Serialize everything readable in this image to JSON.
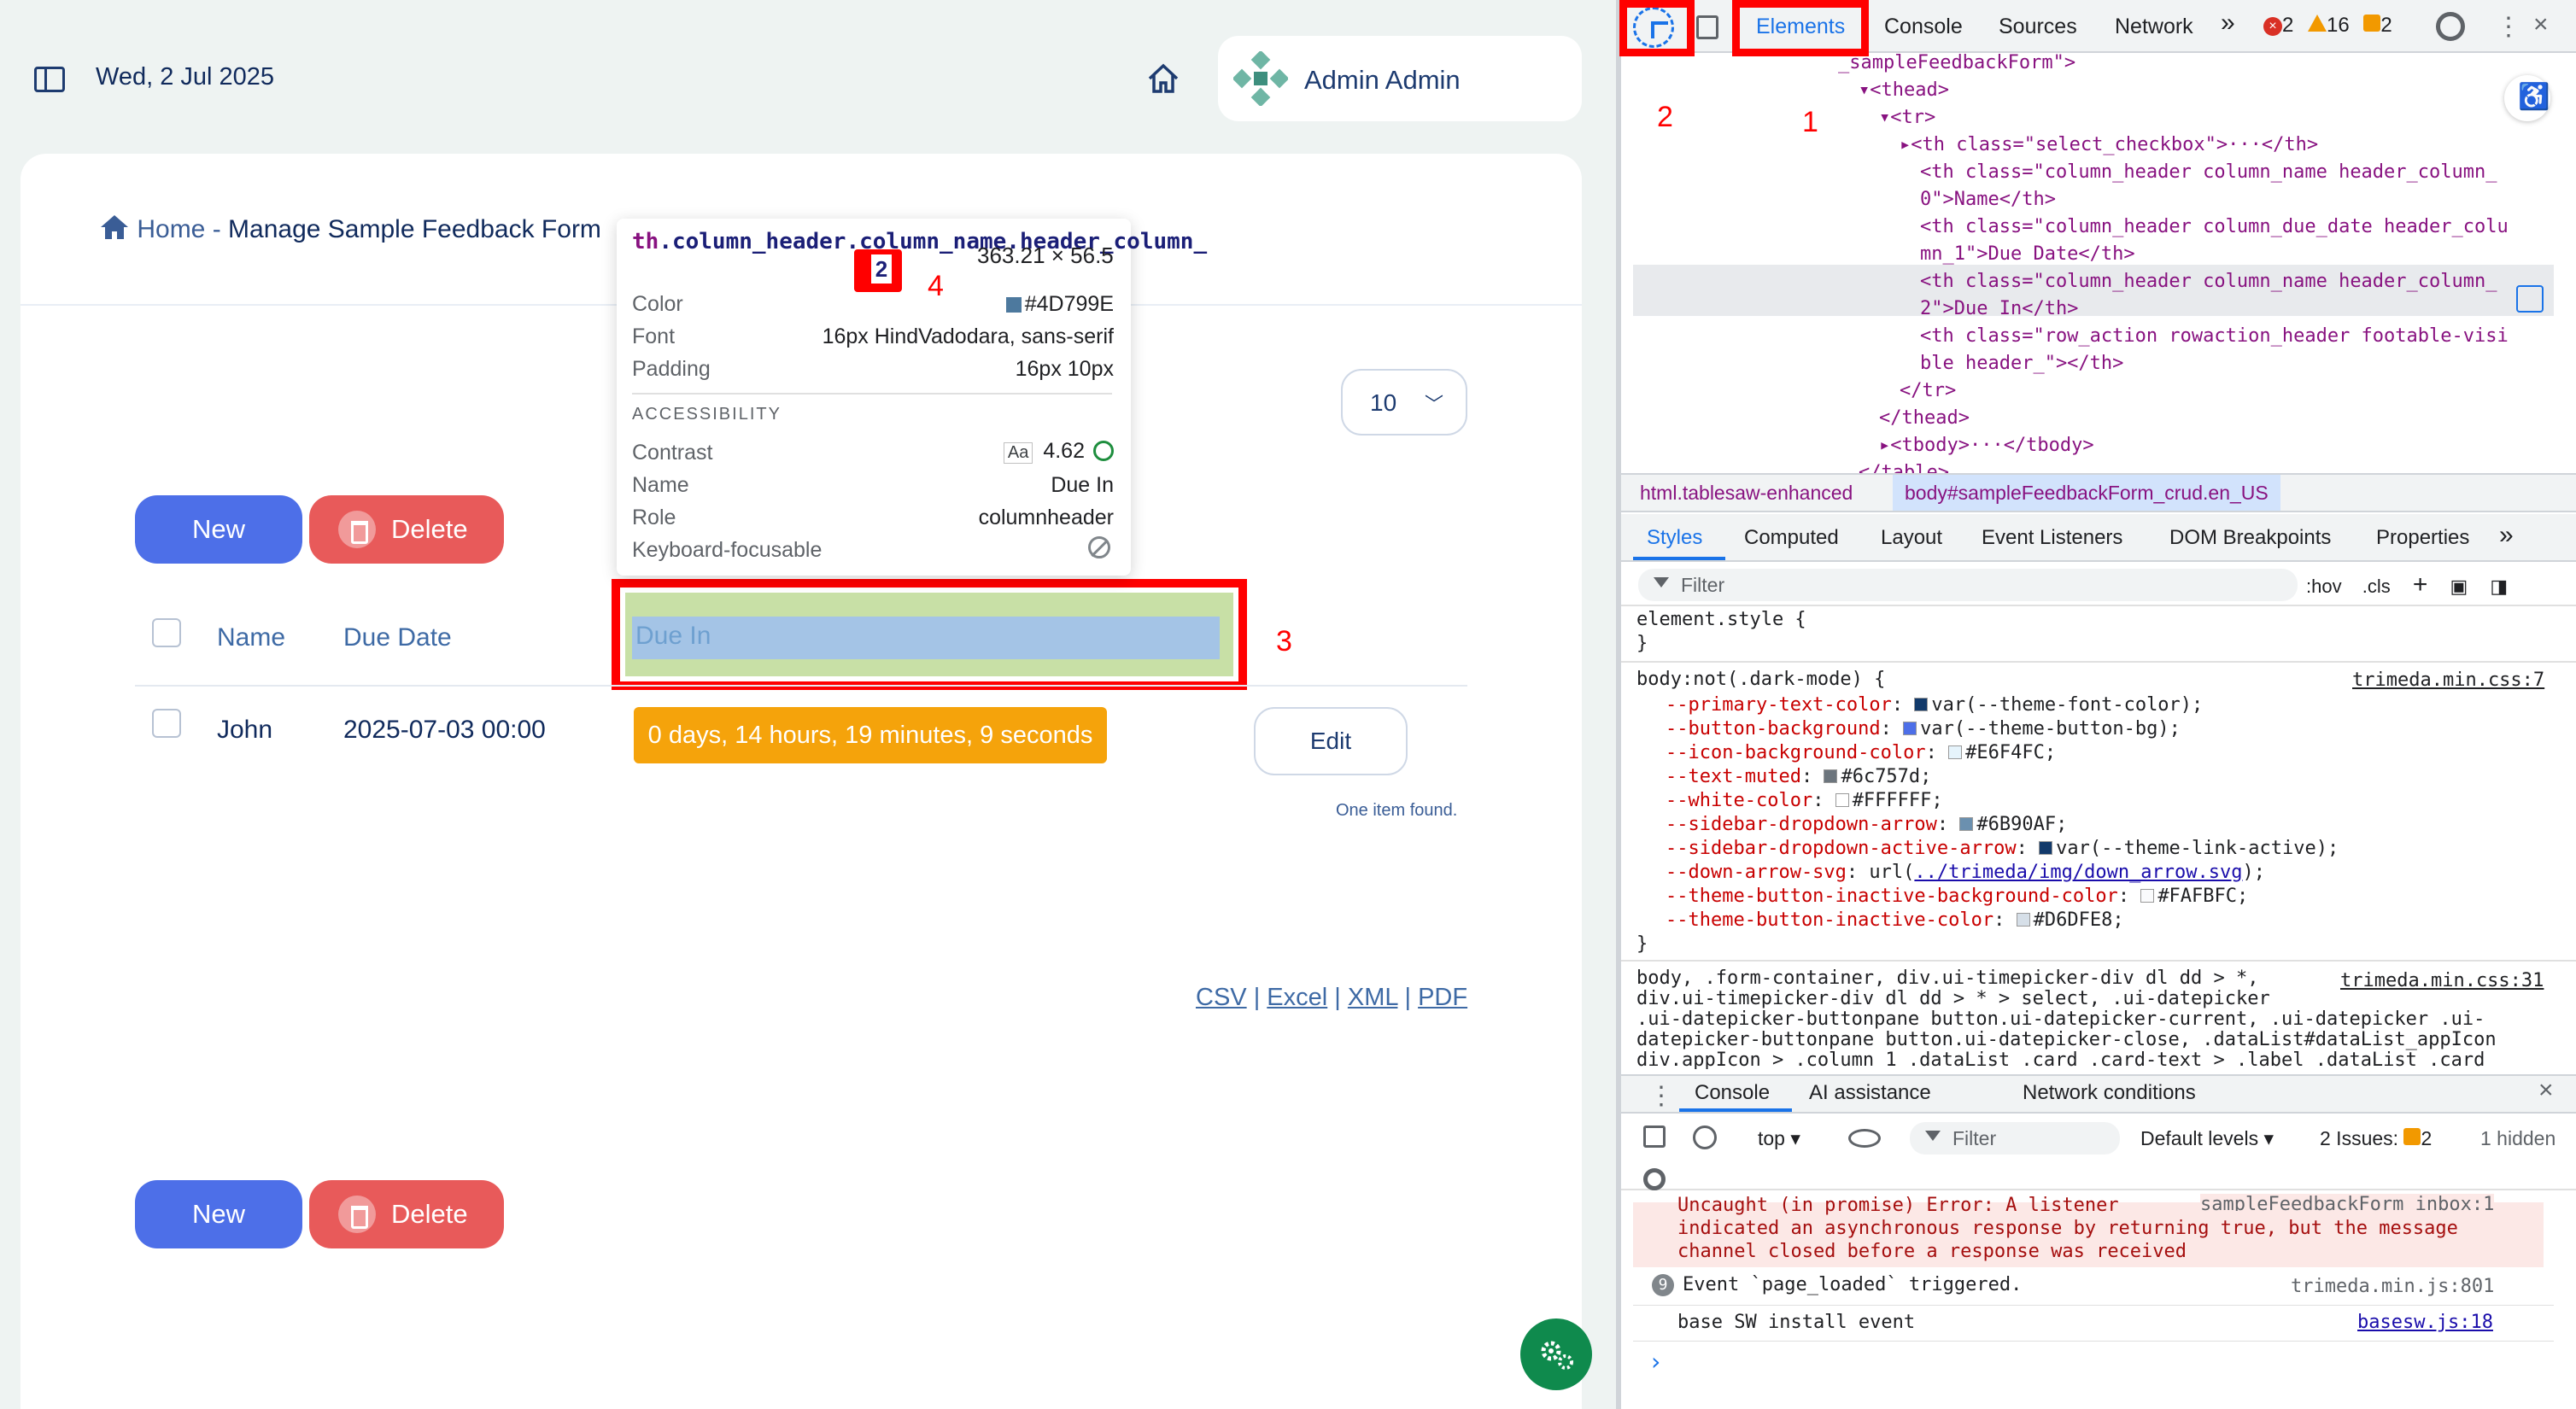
{
  "app": {
    "date": "Wed, 2 Jul 2025",
    "user_name": "Admin Admin",
    "breadcrumb_home": "Home",
    "breadcrumb_sep": " - ",
    "breadcrumb_page": "Manage Sample Feedback Form",
    "page_size": "10",
    "new_label": "New",
    "delete_label": "Delete",
    "columns": [
      "Name",
      "Due Date",
      "Due In"
    ],
    "row": {
      "name": "John",
      "due_date": "2025-07-03 00:00",
      "due_in": "0 days, 14 hours, 19 minutes, 9 seconds",
      "edit_label": "Edit"
    },
    "found_text": "One item found.",
    "exports": [
      "CSV",
      "Excel",
      "XML",
      "PDF"
    ],
    "export_sep": " | ",
    "colors": {
      "new_button": "#4d6fe8",
      "delete_button": "#e85a5a",
      "due_badge": "#f5a30b",
      "fab": "#0f8a4d"
    }
  },
  "tooltip": {
    "tag": "th",
    "selector": ".column_header.column_name.header_column_",
    "selector_number": "2",
    "dimensions": "363.21 × 56.5",
    "color_label": "Color",
    "color_value": "#4D799E",
    "font_label": "Font",
    "font_value": "16px HindVadodara, sans-serif",
    "padding_label": "Padding",
    "padding_value": "16px 10px",
    "section_accessibility": "ACCESSIBILITY",
    "contrast_label": "Contrast",
    "contrast_badge": "Aa",
    "contrast_value": "4.62",
    "name_label": "Name",
    "name_value": "Due In",
    "role_label": "Role",
    "role_value": "columnheader",
    "keyboard_label": "Keyboard-focusable"
  },
  "highlight_text": "Due In",
  "annotations": {
    "a1": "1",
    "a2": "2",
    "a3": "3",
    "a4": "4"
  },
  "devtools": {
    "tabs": [
      "Elements",
      "Console",
      "Sources",
      "Network"
    ],
    "more_tabs": "»",
    "errors": "2",
    "warnings": "16",
    "issues": "2",
    "dom_lines": [
      {
        "indent": 0,
        "html": "_sampleFeedbackForm\">"
      },
      {
        "indent": 1,
        "html": "▾<thead>"
      },
      {
        "indent": 2,
        "html": "▾<tr>"
      },
      {
        "indent": 3,
        "html": "▸<th class=\"select_checkbox\">···</th>"
      },
      {
        "indent": 4,
        "html": "<th class=\"column_header column_name header_column_"
      },
      {
        "indent": 4,
        "html": "0\">Name</th>"
      },
      {
        "indent": 4,
        "html": "<th class=\"column_header column_due_date header_colu"
      },
      {
        "indent": 4,
        "html": "mn_1\">Due Date</th>"
      },
      {
        "indent": 4,
        "html": "<th class=\"column_header column_name header_column_"
      },
      {
        "indent": 4,
        "html": "2\">Due In</th>"
      },
      {
        "indent": 4,
        "html": "<th class=\"row_action rowaction_header footable-visi"
      },
      {
        "indent": 4,
        "html": "ble header_\"></th>"
      },
      {
        "indent": 3,
        "html": "</tr>"
      },
      {
        "indent": 2,
        "html": "</thead>"
      },
      {
        "indent": 2,
        "html": "▸<tbody>···</tbody>"
      },
      {
        "indent": 1,
        "html": "</table>"
      }
    ],
    "crumb_html": "html.tablesaw-enhanced",
    "crumb_body": "body#sampleFeedbackForm_crud.en_US",
    "style_tabs": [
      "Styles",
      "Computed",
      "Layout",
      "Event Listeners",
      "DOM Breakpoints",
      "Properties"
    ],
    "filter_placeholder": "Filter",
    "hov": ":hov",
    "cls": ".cls",
    "element_style": "element.style {",
    "close_brace": "}",
    "rule1_selector": "body:not(.dark-mode) {",
    "rule1_source": "trimeda.min.css:7",
    "rule1_props": [
      {
        "name": "--primary-text-color",
        "value": "var(--theme-font-color);",
        "swatch": "#123a6b"
      },
      {
        "name": "--button-background",
        "value": "var(--theme-button-bg);",
        "swatch": "#4d6fe8"
      },
      {
        "name": "--icon-background-color",
        "value": "#E6F4FC;",
        "swatch": "#E6F4FC"
      },
      {
        "name": "--text-muted",
        "value": "#6c757d;",
        "swatch": "#6c757d"
      },
      {
        "name": "--white-color",
        "value": "#FFFFFF;",
        "swatch": "#FFFFFF"
      },
      {
        "name": "--sidebar-dropdown-arrow",
        "value": "#6B90AF;",
        "swatch": "#6B90AF"
      },
      {
        "name": "--sidebar-dropdown-active-arrow",
        "value": "var(--theme-link-active);",
        "swatch": "#123a6b"
      },
      {
        "name": "--down-arrow-svg",
        "value_prefix": "url(",
        "value_link": "../trimeda/img/down_arrow.svg",
        "value_suffix": ");"
      },
      {
        "name": "--theme-button-inactive-background-color",
        "value": "#FAFBFC;",
        "swatch": "#FAFBFC"
      },
      {
        "name": "--theme-button-inactive-color",
        "value": "#D6DFE8;",
        "swatch": "#D6DFE8"
      }
    ],
    "rule2_lines": [
      "body, .form-container, div.ui-timepicker-div dl dd > *,",
      "div.ui-timepicker-div dl dd > * > select, .ui-datepicker",
      ".ui-datepicker-buttonpane button.ui-datepicker-current, .ui-datepicker .ui-",
      "datepicker-buttonpane button.ui-datepicker-close, .dataList#dataList_appIcon",
      "div.appIcon > .column_1 .dataList .card .card-text > .label .dataList .card"
    ],
    "rule2_source": "trimeda.min.css:31",
    "drawer_tabs": [
      "Console",
      "AI assistance",
      "Network conditions"
    ],
    "context": "top",
    "console_filter": "Filter",
    "levels": "Default levels",
    "issues_text": "2 Issues:",
    "issues_count": "2",
    "hidden_text": "1 hidden",
    "err_lines": [
      "Uncaught (in promise) Error: A listener",
      "indicated an asynchronous response by returning true, but the message",
      "channel closed before a response was received"
    ],
    "err_source": "sampleFeedbackForm_inbox:1",
    "log1_count": "9",
    "log1": "Event `page_loaded` triggered.",
    "log1_source": "trimeda.min.js:801",
    "log2": "base SW install event",
    "log2_source": "basesw.js:18",
    "prompt": "›"
  }
}
